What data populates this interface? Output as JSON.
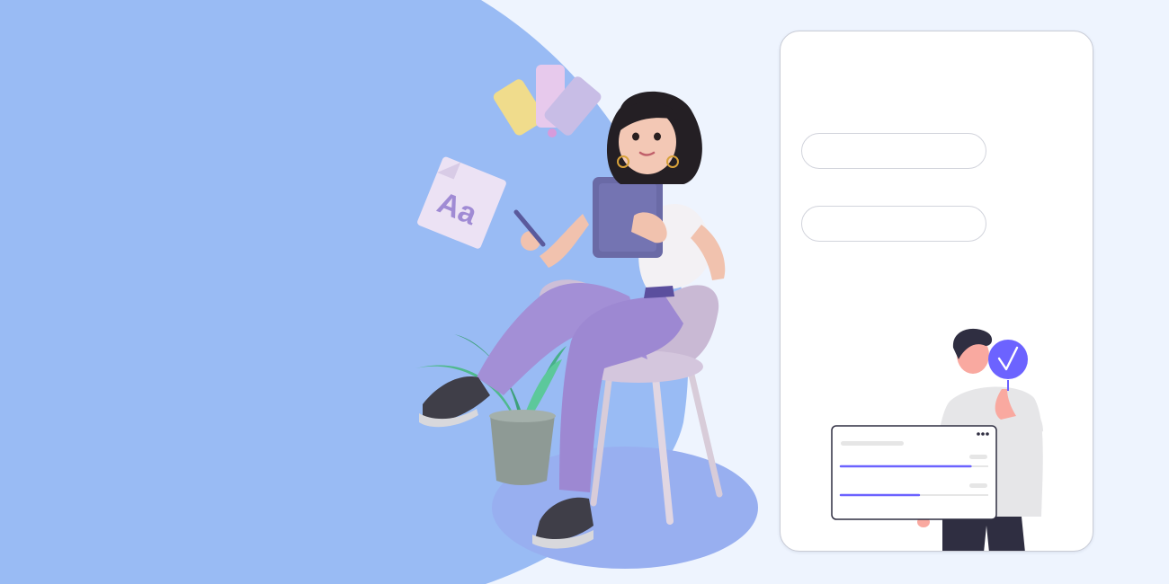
{
  "colors": {
    "page_background": "#eef4fe",
    "blob": "#99bbf4",
    "blob_dark": "#98aff0",
    "card_background": "#ffffff",
    "card_border": "#c9ccd6",
    "accent": "#6c63ff",
    "pants": "#a38fd6",
    "tablet": "#6a6aa6"
  },
  "icons": {
    "check": "check-icon",
    "more": "more-dots-icon",
    "font_swatch": "font-icon",
    "color_palette": "color-palette-icon"
  },
  "decor": {
    "font_sample": "Aa"
  },
  "form": {
    "field_1": {
      "value": "",
      "placeholder": ""
    },
    "field_2": {
      "value": "",
      "placeholder": ""
    }
  },
  "mini_dashboard": {
    "progress": [
      0.88,
      0.53
    ]
  }
}
